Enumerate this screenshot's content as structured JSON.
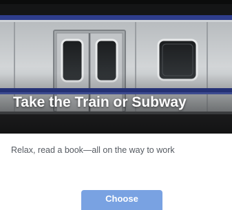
{
  "card": {
    "title": "Take the Train or Subway",
    "description": "Relax, read a book—all on the way to work",
    "button_label": "Choose",
    "image_subject": "subway-train-car"
  },
  "colors": {
    "button_background": "#79a2e2",
    "button_text": "#ffffff",
    "title_text": "#ffffff",
    "description_text": "#555a61"
  }
}
